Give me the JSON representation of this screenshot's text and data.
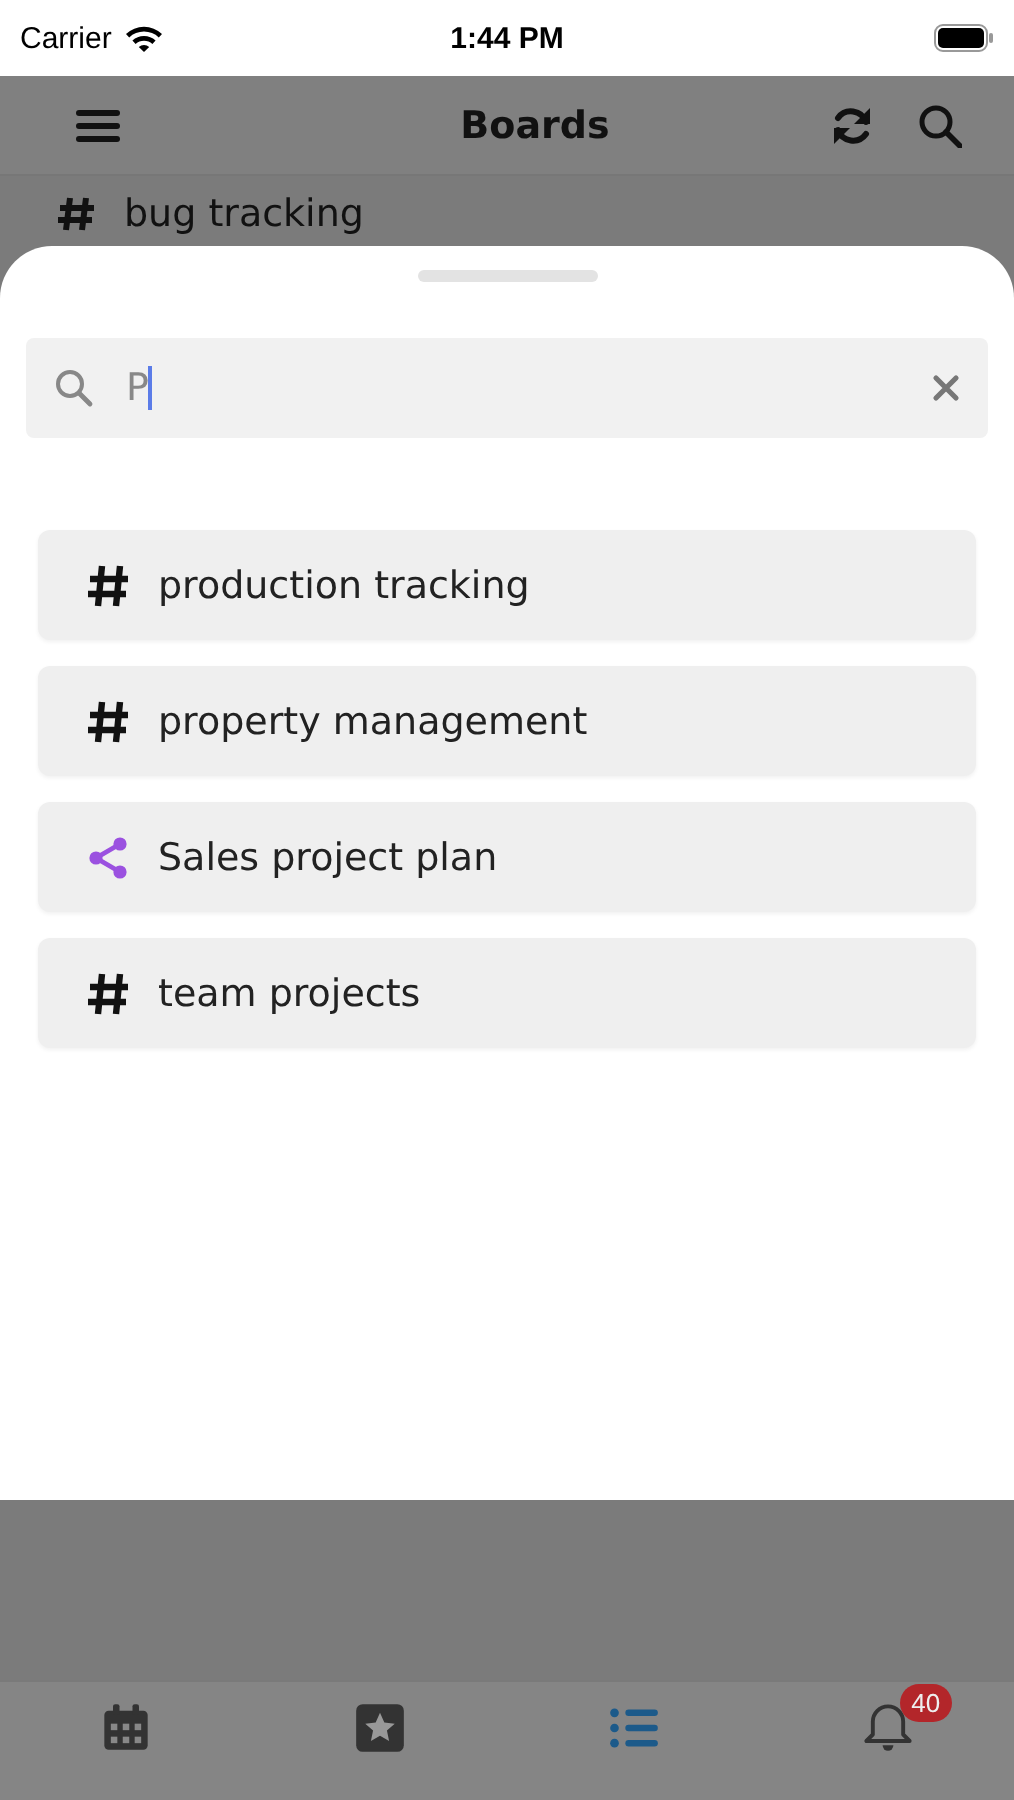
{
  "status_bar": {
    "carrier": "Carrier",
    "time": "1:44 PM"
  },
  "nav_bar": {
    "title": "Boards"
  },
  "background_list": [
    {
      "label": "bug tracking"
    }
  ],
  "sheet": {
    "search": {
      "value": "P"
    },
    "results": [
      {
        "kind": "board",
        "label": "production tracking"
      },
      {
        "kind": "board",
        "label": "property management"
      },
      {
        "kind": "shared",
        "label": "Sales project plan"
      },
      {
        "kind": "board",
        "label": "team projects"
      }
    ]
  },
  "tab_bar": [
    {
      "kind": "calendar",
      "selected": false
    },
    {
      "kind": "favorites",
      "selected": false
    },
    {
      "kind": "list",
      "selected": true
    },
    {
      "kind": "notifications",
      "selected": false,
      "badge": "40"
    }
  ]
}
